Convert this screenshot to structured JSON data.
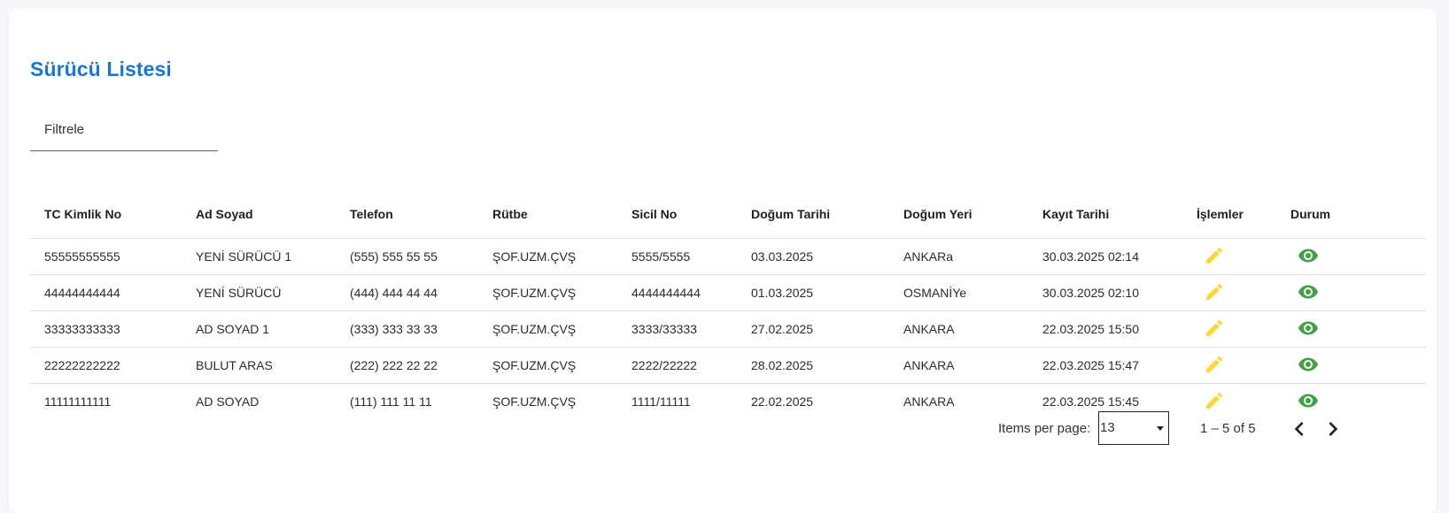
{
  "page": {
    "title": "Sürücü Listesi"
  },
  "filter": {
    "placeholder": "Filtrele",
    "value": ""
  },
  "table": {
    "columns": [
      "TC Kimlik No",
      "Ad Soyad",
      "Telefon",
      "Rütbe",
      "Sicil No",
      "Doğum Tarihi",
      "Doğum Yeri",
      "Kayıt Tarihi",
      "İşlemler",
      "Durum"
    ],
    "rows": [
      [
        "55555555555",
        "YENİ SÜRÜCÜ 1",
        "(555) 555 55 55",
        "ŞOF.UZM.ÇVŞ",
        "5555/5555",
        "03.03.2025",
        "ANKARa",
        "30.03.2025 02:14"
      ],
      [
        "44444444444",
        "YENİ SÜRÜCÜ",
        "(444) 444 44 44",
        "ŞOF.UZM.ÇVŞ",
        "4444444444",
        "01.03.2025",
        "OSMANİYe",
        "30.03.2025 02:10"
      ],
      [
        "33333333333",
        "AD SOYAD 1",
        "(333) 333 33 33",
        "ŞOF.UZM.ÇVŞ",
        "3333/33333",
        "27.02.2025",
        "ANKARA",
        "22.03.2025 15:50"
      ],
      [
        "22222222222",
        "BULUT ARAS",
        "(222) 222 22 22",
        "ŞOF.UZM.ÇVŞ",
        "2222/22222",
        "28.02.2025",
        "ANKARA",
        "22.03.2025 15:47"
      ],
      [
        "11111111111",
        "AD SOYAD",
        "(111) 111 11 11",
        "ŞOF.UZM.ÇVŞ",
        "1111/11111",
        "22.02.2025",
        "ANKARA",
        "22.03.2025 15:45"
      ]
    ],
    "action_icons": {
      "edit": "pencil-icon",
      "status": "eye-icon"
    }
  },
  "paginator": {
    "items_per_page_label": "Items per page:",
    "items_per_page_value": "13",
    "range_label": "1 – 5 of 5",
    "prev_icon": "chevron-left-icon",
    "next_icon": "chevron-right-icon"
  },
  "colors": {
    "title": "#1976d2",
    "edit_icon": "#fdd835",
    "status_icon": "#43a047"
  }
}
